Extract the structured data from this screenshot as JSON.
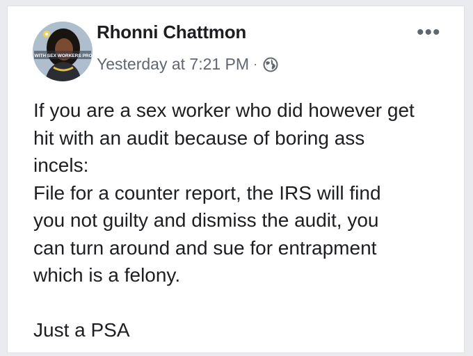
{
  "post": {
    "author_name": "Rhonni Chattmon",
    "timestamp": "Yesterday at 7:21 PM",
    "separator": "·",
    "privacy_icon": "globe-icon",
    "more_icon": "more-options-icon",
    "more_glyph": "•••",
    "avatar": {
      "icon": "avatar",
      "badge_text": "STAND WITH SEX WORKERS PROPERTY"
    },
    "body_lines": [
      "If you are a sex worker who did however get",
      "hit with an audit because of boring ass",
      "incels:",
      "File for a counter report, the IRS will find",
      "you not guilty and dismiss the audit, you",
      "can turn around and sue for entrapment",
      "which is a felony."
    ],
    "closing_line": "Just a PSA"
  }
}
